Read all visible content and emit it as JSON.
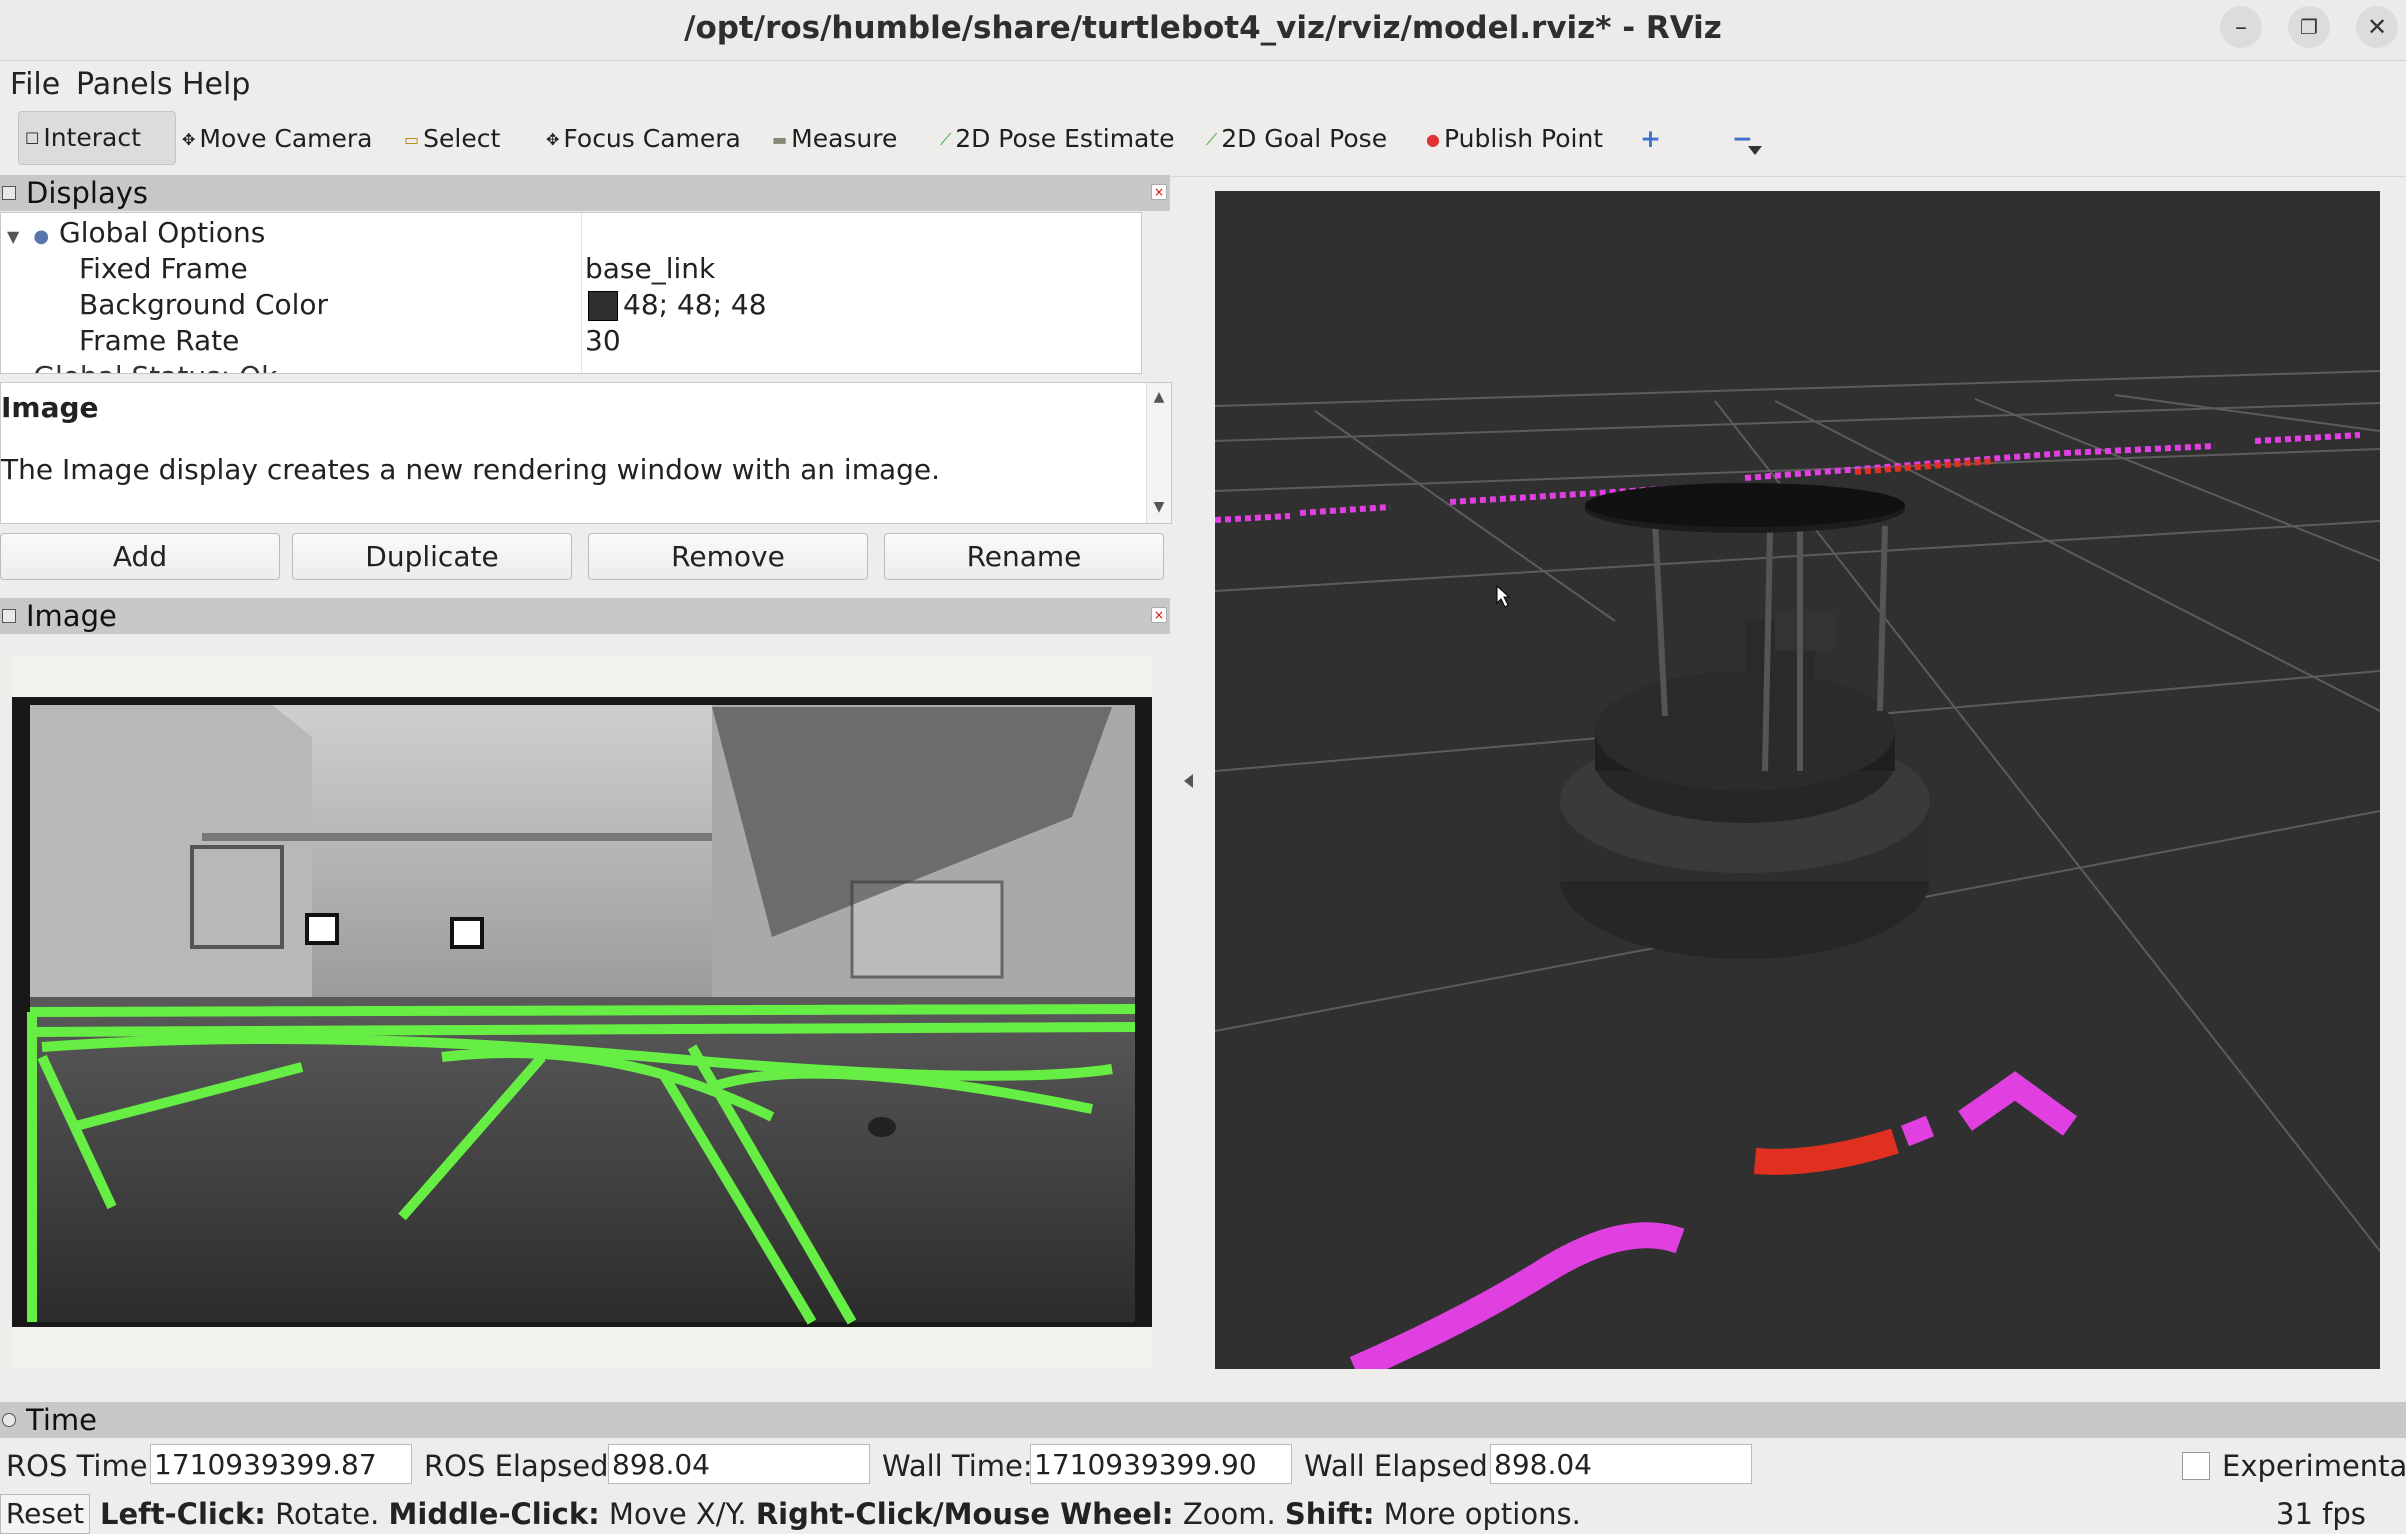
{
  "window": {
    "title": "/opt/ros/humble/share/turtlebot4_viz/rviz/model.rviz* - RViz",
    "minimize": "–",
    "maximize": "❐",
    "close": "✕"
  },
  "menu": {
    "file": "File",
    "panels": "Panels",
    "help": "Help"
  },
  "toolbar": {
    "interact": "Interact",
    "move_camera": "Move Camera",
    "select": "Select",
    "focus_camera": "Focus Camera",
    "measure": "Measure",
    "pose_estimate": "2D Pose Estimate",
    "goal_pose": "2D Goal Pose",
    "publish_point": "Publish Point",
    "add_tool": "+",
    "remove_tool": "−"
  },
  "displays": {
    "header": "Displays",
    "global_options": "Global Options",
    "rows": [
      {
        "name": "Fixed Frame",
        "value": "base_link"
      },
      {
        "name": "Background Color",
        "value": "48; 48; 48",
        "color": "#303030"
      },
      {
        "name": "Frame Rate",
        "value": "30"
      }
    ],
    "cut_row": "Global Status: Ok"
  },
  "description": {
    "title": "Image",
    "text": "The Image display creates a new rendering window with an image."
  },
  "buttons": {
    "add": "Add",
    "duplicate": "Duplicate",
    "remove": "Remove",
    "rename": "Rename"
  },
  "image_panel": {
    "header": "Image"
  },
  "time": {
    "header": "Time",
    "ros_time_label": "ROS Time:",
    "ros_time": "1710939399.87",
    "ros_elapsed_label": "ROS Elapsed:",
    "ros_elapsed": "898.04",
    "wall_time_label": "Wall Time:",
    "wall_time": "1710939399.90",
    "wall_elapsed_label": "Wall Elapsed:",
    "wall_elapsed": "898.04",
    "experimental": "Experimental"
  },
  "status": {
    "reset": "Reset",
    "k1": "Left-Click:",
    "v1": " Rotate. ",
    "k2": "Middle-Click:",
    "v2": " Move X/Y. ",
    "k3": "Right-Click/Mouse Wheel:",
    "v3": " Zoom. ",
    "k4": "Shift:",
    "v4": " More options.",
    "fps": "31 fps"
  },
  "colors": {
    "view_background": "#303030",
    "laser_scan": "#e040e0",
    "highlight_scan": "#e03020",
    "lane_overlay": "#66ee44"
  }
}
